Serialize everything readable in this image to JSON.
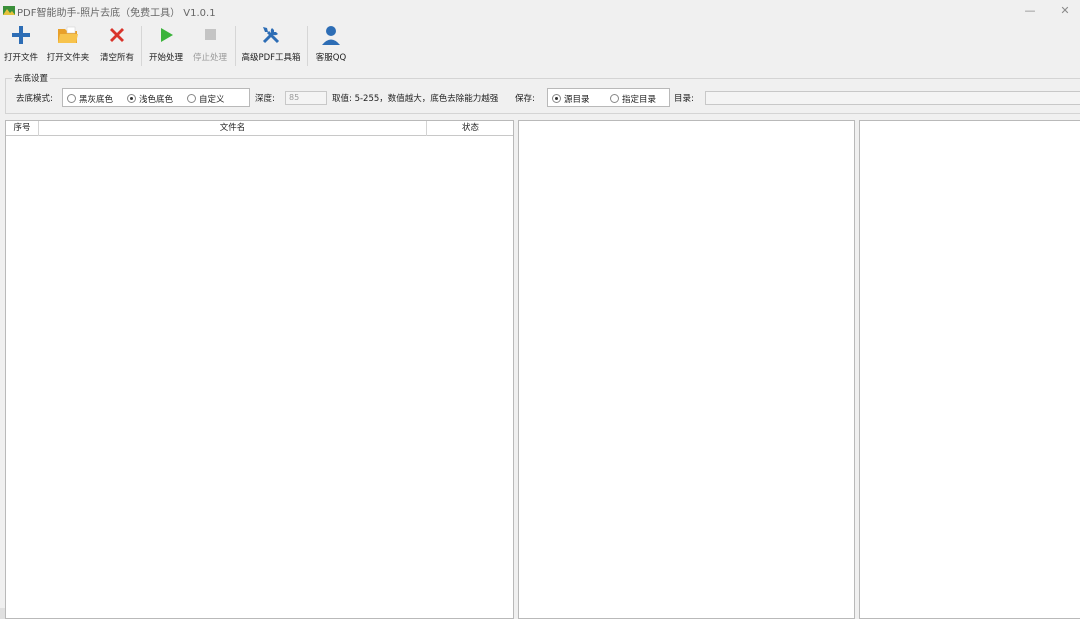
{
  "window": {
    "title": "PDF智能助手-照片去底（免费工具） V1.0.1",
    "minimize": "—",
    "close": "✕"
  },
  "toolbar": {
    "open_file": "打开文件",
    "open_folder": "打开文件夹",
    "clear_all": "清空所有",
    "start": "开始处理",
    "stop": "停止处理",
    "advanced": "高级PDF工具箱",
    "support": "客服QQ"
  },
  "settings": {
    "group_title": "去底设置",
    "mode_label": "去底模式:",
    "mode_options": [
      "黑灰底色",
      "浅色底色",
      "自定义"
    ],
    "mode_selected": "浅色底色",
    "depth_label": "深度:",
    "depth_value": "85",
    "range_hint": "取值: 5-255，数值越大，底色去除能力越强",
    "save_label": "保存:",
    "save_options": [
      "源目录",
      "指定目录"
    ],
    "save_selected": "源目录",
    "dir_label": "目录:",
    "dir_value": ""
  },
  "file_list": {
    "columns": [
      "序号",
      "文件名",
      "状态"
    ],
    "rows": []
  },
  "colors": {
    "accent_blue": "#2d6db5",
    "start_green": "#3bb33b",
    "clear_red": "#d9342b",
    "folder_orange": "#f0a92c"
  }
}
